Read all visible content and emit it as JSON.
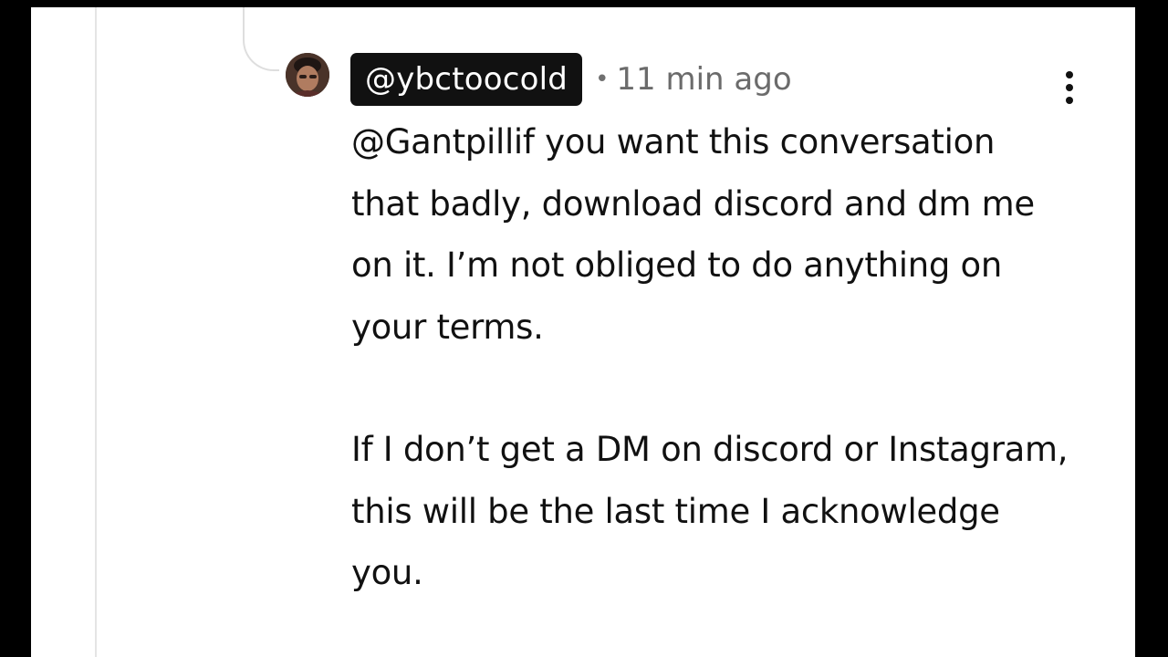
{
  "comment": {
    "author": "@ybctoocold",
    "separator": "•",
    "timestamp": "11 min ago",
    "body": {
      "paragraph_1": "@Gantpillif you want this conversation that badly, download discord and dm me on it. I’m not obliged to do anything on your terms.",
      "paragraph_2": "If I don’t get a DM on discord or Instagram, this will be the last time I acknowledge you."
    },
    "avatar_icon": "user-avatar",
    "menu_icon": "more-vertical-icon"
  },
  "colors": {
    "background": "#ffffff",
    "outer_frame": "#000000",
    "username_chip_bg": "#111111",
    "username_chip_text": "#ffffff",
    "timestamp": "#6b6b6b",
    "body_text": "#111111",
    "thread_line": "#e4e4e4"
  }
}
